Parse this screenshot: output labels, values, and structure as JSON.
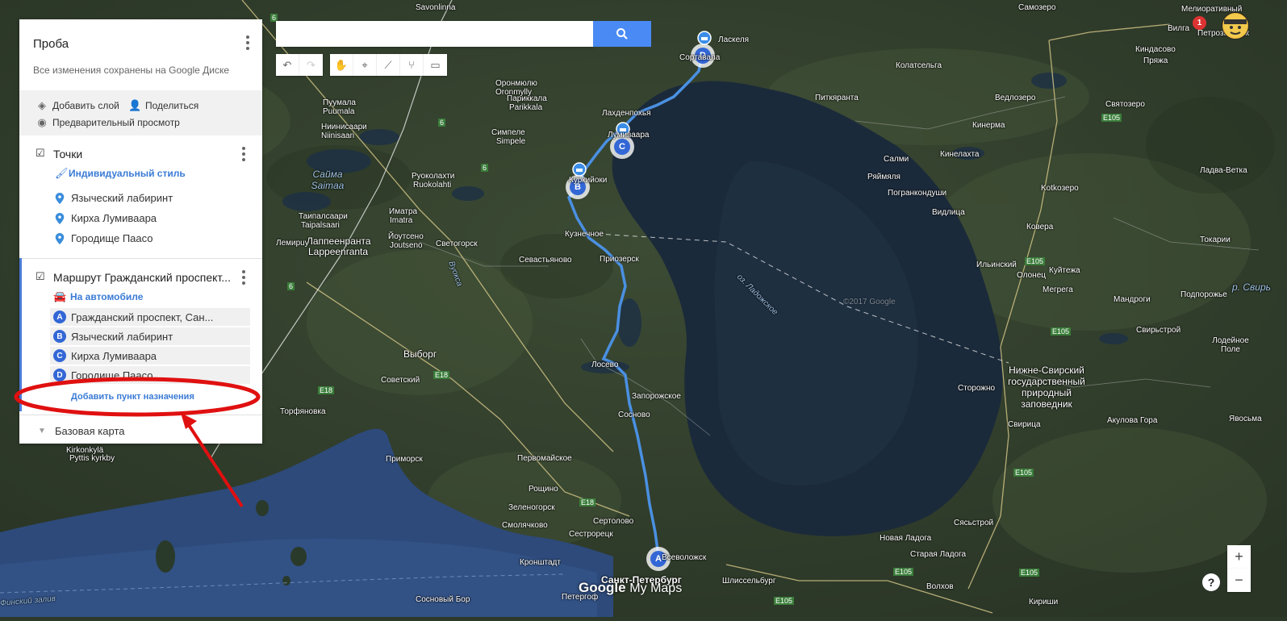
{
  "panel": {
    "title": "Проба",
    "subtitle": "Все изменения сохранены на Google Диске",
    "add_layer": "Добавить слой",
    "share": "Поделиться",
    "preview": "Предварительный просмотр",
    "layer1": {
      "title": "Точки",
      "style": "Индивидуальный стиль",
      "points": [
        "Языческий лабиринт",
        "Кирха Лумиваара",
        "Городище Паасо"
      ]
    },
    "layer2": {
      "title": "Маршрут Гражданский проспект...",
      "mode": "На автомобиле",
      "waypoints": [
        {
          "letter": "A",
          "label": "Гражданский проспект, Сан..."
        },
        {
          "letter": "B",
          "label": "Языческий лабиринт"
        },
        {
          "letter": "C",
          "label": "Кирха Лумиваара"
        },
        {
          "letter": "D",
          "label": "Городище Паасо"
        }
      ],
      "add_destination": "Добавить пункт назначения"
    },
    "basemap": "Базовая карта"
  },
  "search": {
    "value": "",
    "placeholder": ""
  },
  "toolbar_icons": [
    "undo-icon",
    "redo-icon",
    "hand-icon",
    "marker-icon",
    "draw-line-icon",
    "directions-icon",
    "ruler-icon"
  ],
  "zoom": {
    "plus": "+",
    "minus": "−"
  },
  "help": "?",
  "notification_count": "1",
  "watermark": {
    "google": "Google",
    "mymaps": "My Maps"
  },
  "map_labels": {
    "cities": [
      "Savonlinna",
      "Ласкеля",
      "Сортавала",
      "Питкяранта",
      "Колатсельга",
      "Кинелахта",
      "Салми",
      "Ряймяля",
      "Погранкондуши",
      "Видлица",
      "Kotkoзеро",
      "Кинерма",
      "Ведлозеро",
      "Святозеро",
      "Ладва-Ветка",
      "Коверa",
      "Токарии",
      "Ильинский",
      "Олонец",
      "Куйтежа",
      "Мегрега",
      "Мандроги",
      "Подпорожье",
      "Свирьстрой",
      "Лодейное Поле",
      "Нижне-Свирский государственный природный заповедник",
      "Сторожно",
      "Свирица",
      "Акулова Гора",
      "Явосьма",
      "Новая Ладога",
      "Сясьстрой",
      "Старая Ладога",
      "Волхов",
      "Кириши",
      "Шлиссельбург",
      "Всеволожск",
      "Санкт-Петербург",
      "Сертолово",
      "Сестрорецк",
      "Кронштадт",
      "Сосновый Бор",
      "Петергоф",
      "Рощино",
      "Зеленогорск",
      "Смолячково",
      "Приморск",
      "Первомайское",
      "Выборг",
      "Советский",
      "Торфяновка",
      "Лосево",
      "Запорожское",
      "Сосново",
      "Приозерск",
      "Кузнечное",
      "Севастьяново",
      "Светогорск",
      "Лаппеенранта",
      "Lappeenranta",
      "Иматра",
      "Imatra",
      "Йоутсено",
      "Joutseno",
      "Руоколахти",
      "Ruokolahti",
      "Таипалсаари",
      "Taipalsaari",
      "Лахденпохья",
      "Лумиваара",
      "Куркийоки",
      "Париккала",
      "Parikkala",
      "Симпеле",
      "Simpele",
      "Пуумала",
      "Puumala",
      "Ниинисаари",
      "Niinisaari",
      "Оронмюлю",
      "Oronmylly",
      "Лемиpuy",
      "Вилга",
      "Петрозаводск",
      "Мелиоративный",
      "Кинда​сово",
      "Пряжа",
      "Самозеро",
      "Kirkonkylä",
      "Pyttis kyrkby"
    ],
    "water": [
      "Сайма Saimaa",
      "оз. Ладожское",
      "р. Свирь",
      "Вуокса",
      "Финский залив"
    ],
    "roads": [
      "6",
      "6",
      "6",
      "6",
      "E18",
      "E18",
      "E18",
      "E105",
      "E105",
      "E105",
      "E105",
      "E105",
      "E105",
      "E105"
    ],
    "copyright": "©2017 Google"
  }
}
